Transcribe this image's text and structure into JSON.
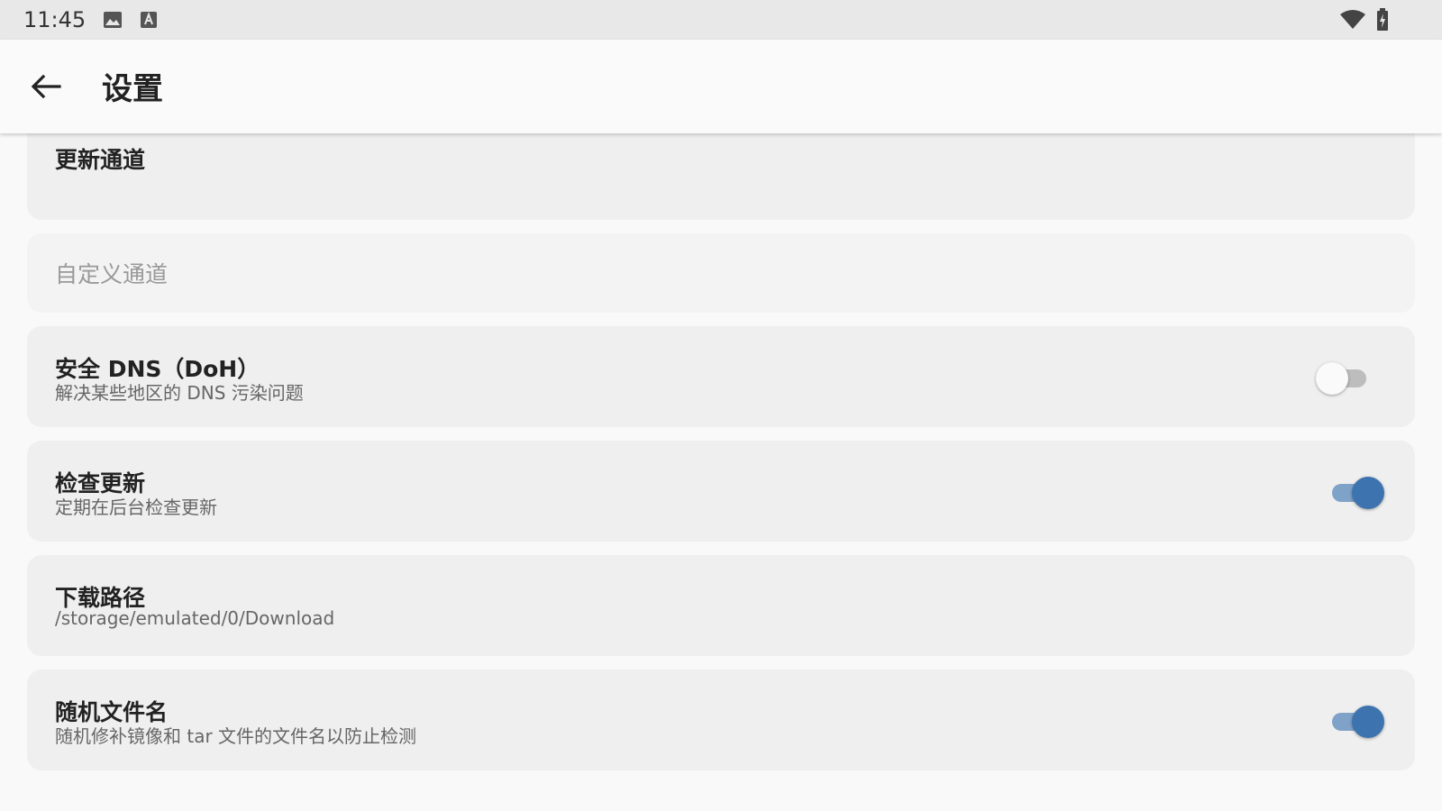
{
  "status_bar": {
    "time": "11:45",
    "icons": [
      "image-icon",
      "text-a-icon",
      "wifi-icon",
      "battery-charging-icon"
    ]
  },
  "app_bar": {
    "back_icon": "arrow-left-icon",
    "title": "设置"
  },
  "settings": {
    "update_channel": {
      "title": "更新通道"
    },
    "custom_channel": {
      "title": "自定义通道"
    },
    "secure_dns": {
      "title": "安全 DNS（DoH）",
      "subtitle": "解决某些地区的 DNS 污染问题",
      "enabled": false
    },
    "check_updates": {
      "title": "检查更新",
      "subtitle": "定期在后台检查更新",
      "enabled": true
    },
    "download_path": {
      "title": "下载路径",
      "subtitle": "/storage/emulated/0/Download"
    },
    "random_filename": {
      "title": "随机文件名",
      "subtitle": "随机修补镜像和 tar 文件的文件名以防止检测",
      "enabled": true
    }
  },
  "colors": {
    "accent": "#3d74b0",
    "accent_track": "#7fa2c8",
    "card_bg": "#efefef",
    "page_bg": "#f9f9f9"
  }
}
